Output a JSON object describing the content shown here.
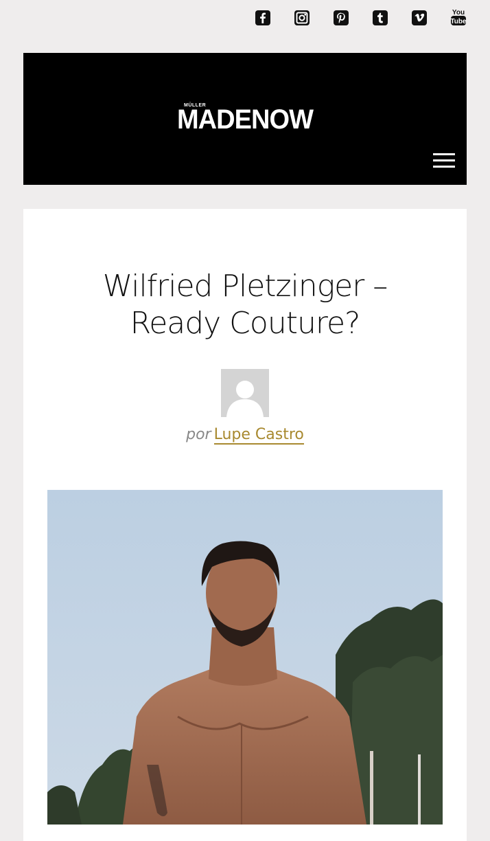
{
  "social": {
    "icons": [
      {
        "name": "facebook-icon"
      },
      {
        "name": "instagram-icon"
      },
      {
        "name": "pinterest-icon"
      },
      {
        "name": "tumblr-icon"
      },
      {
        "name": "vimeo-icon"
      },
      {
        "name": "youtube-icon",
        "text_top": "You",
        "text_bottom": "Tube"
      }
    ]
  },
  "header": {
    "logo_small": "MÜLLER",
    "logo_main": "MADENOW",
    "menu_icon": "hamburger-icon"
  },
  "article": {
    "title_line1": "Wilfried Pletzinger –",
    "title_line2": "Ready Couture?",
    "byline_prefix": "por",
    "author": "Lupe Castro"
  },
  "colors": {
    "background": "#efeded",
    "header_bg": "#000000",
    "author_link": "#a8892f"
  }
}
